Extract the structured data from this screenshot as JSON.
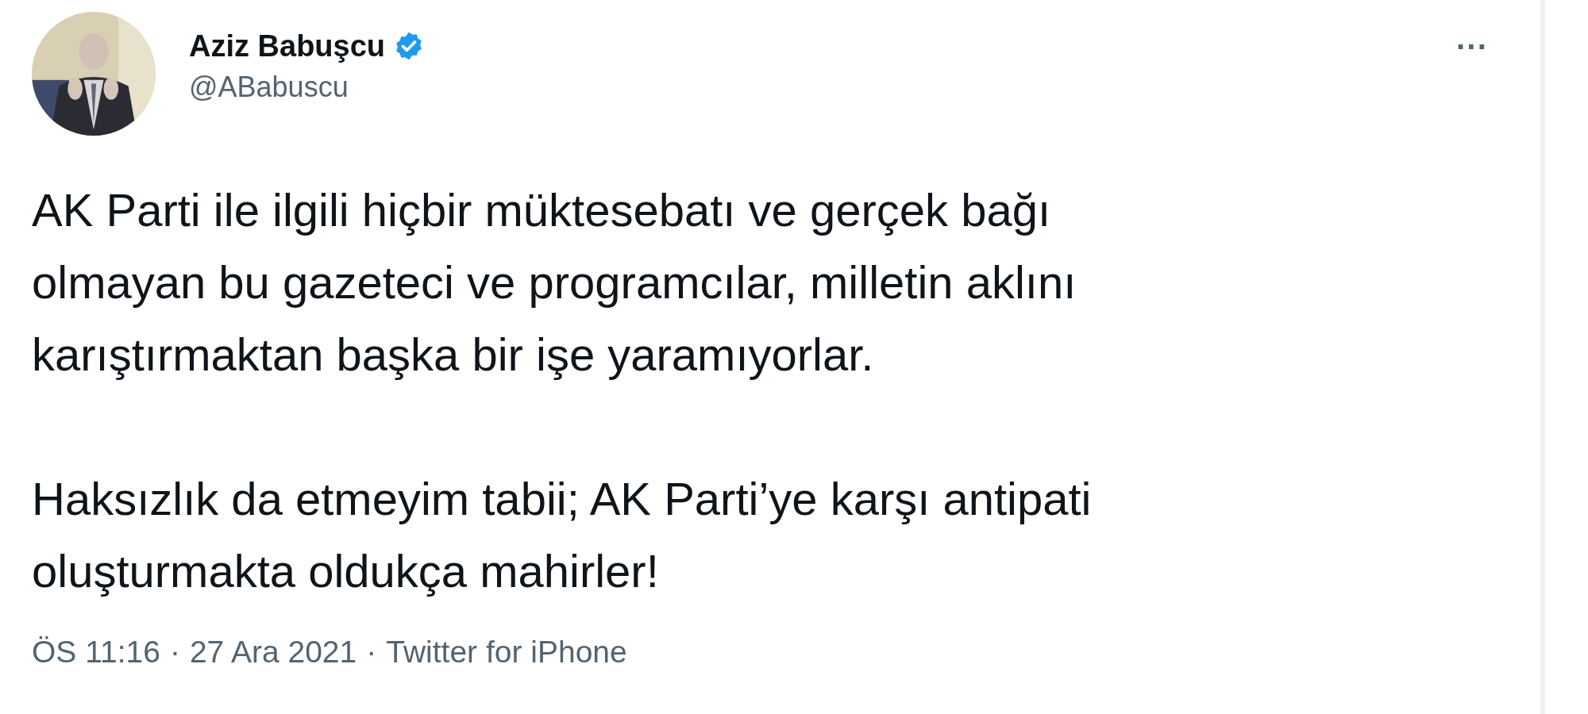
{
  "author": {
    "name": "Aziz Babuşcu",
    "verified": true,
    "handle": "@ABabuscu"
  },
  "more": "···",
  "paragraphs": [
    [
      "AK Parti ile ilgili hiçbir müktesebatı ve gerçek bağı",
      "olmayan bu gazeteci ve programcılar, milletin aklını",
      "karıştırmaktan başka bir işe yaramıyorlar."
    ],
    [
      "Haksızlık da etmeyim tabii; AK Parti’ye karşı antipati",
      "oluşturmakta oldukça mahirler!"
    ]
  ],
  "footer": {
    "time": "ÖS 11:16",
    "separator_1": "·",
    "date": "27 Ara 2021",
    "separator_2": "·",
    "source": "Twitter for iPhone"
  }
}
